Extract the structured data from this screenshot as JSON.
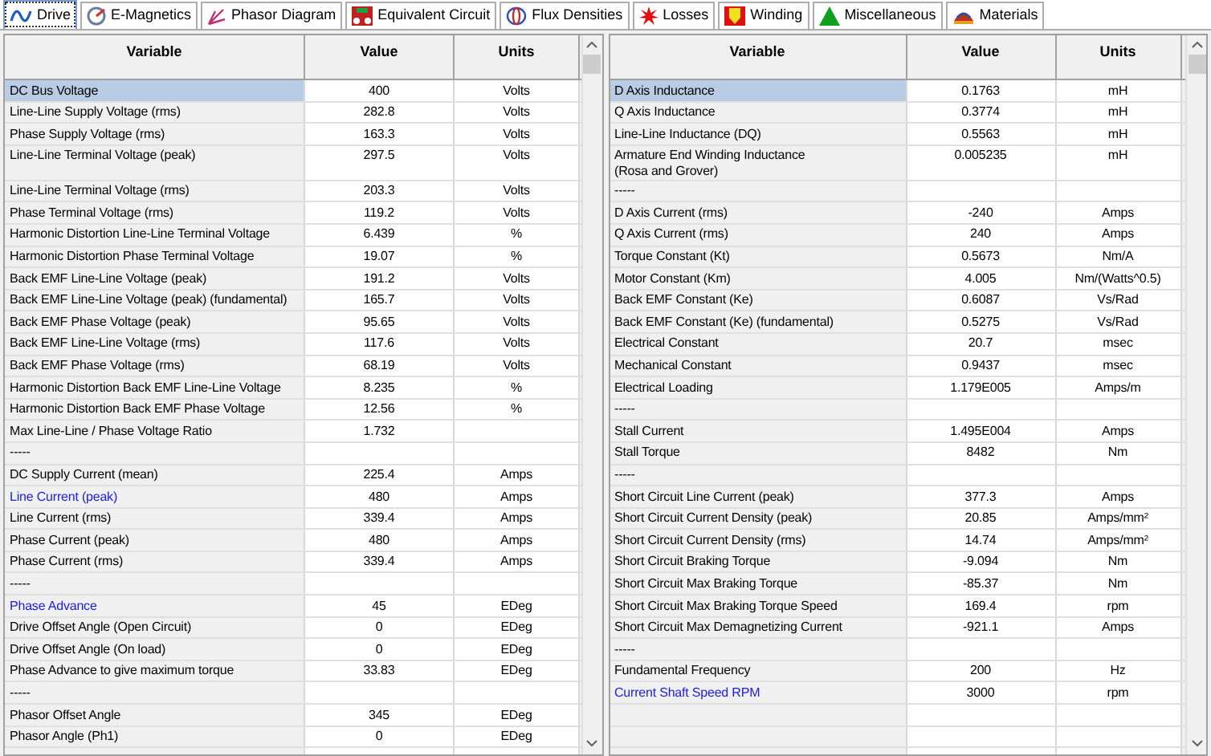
{
  "tabs": [
    {
      "label": "Drive",
      "selected": true
    },
    {
      "label": "E-Magnetics",
      "selected": false
    },
    {
      "label": "Phasor Diagram",
      "selected": false
    },
    {
      "label": "Equivalent Circuit",
      "selected": false
    },
    {
      "label": "Flux Densities",
      "selected": false
    },
    {
      "label": "Losses",
      "selected": false
    },
    {
      "label": "Winding",
      "selected": false
    },
    {
      "label": "Miscellaneous",
      "selected": false
    },
    {
      "label": "Materials",
      "selected": false
    }
  ],
  "tables": [
    {
      "columns": [
        "Variable",
        "Value",
        "Units"
      ],
      "rows": [
        {
          "variable": "DC Bus Voltage",
          "value": "400",
          "units": "Volts",
          "link": false,
          "selected": true
        },
        {
          "variable": "Line-Line Supply Voltage (rms)",
          "value": "282.8",
          "units": "Volts",
          "link": false,
          "selected": false
        },
        {
          "variable": "Phase Supply Voltage (rms)",
          "value": "163.3",
          "units": "Volts",
          "link": false,
          "selected": false
        },
        {
          "variable": "Line-Line Terminal Voltage (peak)",
          "value": "297.5",
          "units": "Volts",
          "link": false,
          "selected": false,
          "tall": true
        },
        {
          "variable": "Line-Line Terminal Voltage (rms)",
          "value": "203.3",
          "units": "Volts",
          "link": false,
          "selected": false
        },
        {
          "variable": "Phase Terminal Voltage (rms)",
          "value": "119.2",
          "units": "Volts",
          "link": false,
          "selected": false
        },
        {
          "variable": "Harmonic Distortion Line-Line Terminal Voltage",
          "value": "6.439",
          "units": "%",
          "link": false,
          "selected": false
        },
        {
          "variable": "Harmonic Distortion Phase Terminal Voltage",
          "value": "19.07",
          "units": "%",
          "link": false,
          "selected": false
        },
        {
          "variable": "Back EMF Line-Line Voltage (peak)",
          "value": "191.2",
          "units": "Volts",
          "link": false,
          "selected": false
        },
        {
          "variable": "Back EMF Line-Line Voltage (peak) (fundamental)",
          "value": "165.7",
          "units": "Volts",
          "link": false,
          "selected": false
        },
        {
          "variable": "Back EMF Phase Voltage (peak)",
          "value": "95.65",
          "units": "Volts",
          "link": false,
          "selected": false
        },
        {
          "variable": "Back EMF Line-Line Voltage (rms)",
          "value": "117.6",
          "units": "Volts",
          "link": false,
          "selected": false
        },
        {
          "variable": "Back EMF Phase Voltage (rms)",
          "value": "68.19",
          "units": "Volts",
          "link": false,
          "selected": false
        },
        {
          "variable": "Harmonic Distortion Back EMF Line-Line Voltage",
          "value": "8.235",
          "units": "%",
          "link": false,
          "selected": false
        },
        {
          "variable": "Harmonic Distortion Back EMF Phase Voltage",
          "value": "12.56",
          "units": "%",
          "link": false,
          "selected": false
        },
        {
          "variable": "Max Line-Line / Phase Voltage Ratio",
          "value": "1.732",
          "units": "",
          "link": false,
          "selected": false
        },
        {
          "variable": "-----",
          "value": "",
          "units": "",
          "link": false,
          "selected": false
        },
        {
          "variable": "DC Supply Current (mean)",
          "value": "225.4",
          "units": "Amps",
          "link": false,
          "selected": false
        },
        {
          "variable": "Line Current (peak)",
          "value": "480",
          "units": "Amps",
          "link": true,
          "selected": false
        },
        {
          "variable": "Line Current (rms)",
          "value": "339.4",
          "units": "Amps",
          "link": false,
          "selected": false
        },
        {
          "variable": "Phase Current (peak)",
          "value": "480",
          "units": "Amps",
          "link": false,
          "selected": false
        },
        {
          "variable": "Phase Current (rms)",
          "value": "339.4",
          "units": "Amps",
          "link": false,
          "selected": false
        },
        {
          "variable": "-----",
          "value": "",
          "units": "",
          "link": false,
          "selected": false
        },
        {
          "variable": "Phase Advance",
          "value": "45",
          "units": "EDeg",
          "link": true,
          "selected": false
        },
        {
          "variable": "Drive Offset Angle (Open Circuit)",
          "value": "0",
          "units": "EDeg",
          "link": false,
          "selected": false
        },
        {
          "variable": "Drive Offset Angle (On load)",
          "value": "0",
          "units": "EDeg",
          "link": false,
          "selected": false
        },
        {
          "variable": "Phase Advance to give maximum torque",
          "value": "33.83",
          "units": "EDeg",
          "link": false,
          "selected": false
        },
        {
          "variable": "-----",
          "value": "",
          "units": "",
          "link": false,
          "selected": false
        },
        {
          "variable": "Phasor Offset Angle",
          "value": "345",
          "units": "EDeg",
          "link": false,
          "selected": false
        },
        {
          "variable": "Phasor Angle (Ph1)",
          "value": "0",
          "units": "EDeg",
          "link": false,
          "selected": false
        }
      ]
    },
    {
      "columns": [
        "Variable",
        "Value",
        "Units"
      ],
      "rows": [
        {
          "variable": "D Axis Inductance",
          "value": "0.1763",
          "units": "mH",
          "link": false,
          "selected": true
        },
        {
          "variable": "Q Axis Inductance",
          "value": "0.3774",
          "units": "mH",
          "link": false,
          "selected": false
        },
        {
          "variable": "Line-Line Inductance (DQ)",
          "value": "0.5563",
          "units": "mH",
          "link": false,
          "selected": false
        },
        {
          "variable": "Armature End Winding Inductance\n(Rosa and Grover)",
          "value": "0.005235",
          "units": "mH",
          "link": false,
          "selected": false,
          "tall": true
        },
        {
          "variable": "-----",
          "value": "",
          "units": "",
          "link": false,
          "selected": false
        },
        {
          "variable": "D Axis Current (rms)",
          "value": "-240",
          "units": "Amps",
          "link": false,
          "selected": false
        },
        {
          "variable": "Q Axis Current (rms)",
          "value": "240",
          "units": "Amps",
          "link": false,
          "selected": false
        },
        {
          "variable": "Torque Constant (Kt)",
          "value": "0.5673",
          "units": "Nm/A",
          "link": false,
          "selected": false
        },
        {
          "variable": "Motor Constant (Km)",
          "value": "4.005",
          "units": "Nm/(Watts^0.5)",
          "link": false,
          "selected": false
        },
        {
          "variable": "Back EMF Constant (Ke)",
          "value": "0.6087",
          "units": "Vs/Rad",
          "link": false,
          "selected": false
        },
        {
          "variable": "Back EMF Constant (Ke) (fundamental)",
          "value": "0.5275",
          "units": "Vs/Rad",
          "link": false,
          "selected": false
        },
        {
          "variable": "Electrical Constant",
          "value": "20.7",
          "units": "msec",
          "link": false,
          "selected": false
        },
        {
          "variable": "Mechanical Constant",
          "value": "0.9437",
          "units": "msec",
          "link": false,
          "selected": false
        },
        {
          "variable": "Electrical Loading",
          "value": "1.179E005",
          "units": "Amps/m",
          "link": false,
          "selected": false
        },
        {
          "variable": "-----",
          "value": "",
          "units": "",
          "link": false,
          "selected": false
        },
        {
          "variable": "Stall Current",
          "value": "1.495E004",
          "units": "Amps",
          "link": false,
          "selected": false
        },
        {
          "variable": "Stall Torque",
          "value": "8482",
          "units": "Nm",
          "link": false,
          "selected": false
        },
        {
          "variable": "-----",
          "value": "",
          "units": "",
          "link": false,
          "selected": false
        },
        {
          "variable": "Short Circuit Line Current (peak)",
          "value": "377.3",
          "units": "Amps",
          "link": false,
          "selected": false
        },
        {
          "variable": "Short Circuit Current Density (peak)",
          "value": "20.85",
          "units": "Amps/mm²",
          "link": false,
          "selected": false
        },
        {
          "variable": "Short Circuit Current Density (rms)",
          "value": "14.74",
          "units": "Amps/mm²",
          "link": false,
          "selected": false
        },
        {
          "variable": "Short Circuit Braking Torque",
          "value": "-9.094",
          "units": "Nm",
          "link": false,
          "selected": false
        },
        {
          "variable": "Short Circuit Max Braking Torque",
          "value": "-85.37",
          "units": "Nm",
          "link": false,
          "selected": false
        },
        {
          "variable": "Short Circuit Max Braking Torque Speed",
          "value": "169.4",
          "units": "rpm",
          "link": false,
          "selected": false
        },
        {
          "variable": "Short Circuit Max Demagnetizing Current",
          "value": "-921.1",
          "units": "Amps",
          "link": false,
          "selected": false
        },
        {
          "variable": "-----",
          "value": "",
          "units": "",
          "link": false,
          "selected": false
        },
        {
          "variable": "Fundamental Frequency",
          "value": "200",
          "units": "Hz",
          "link": false,
          "selected": false
        },
        {
          "variable": "Current Shaft Speed RPM",
          "value": "3000",
          "units": "rpm",
          "link": true,
          "selected": false
        }
      ]
    }
  ]
}
